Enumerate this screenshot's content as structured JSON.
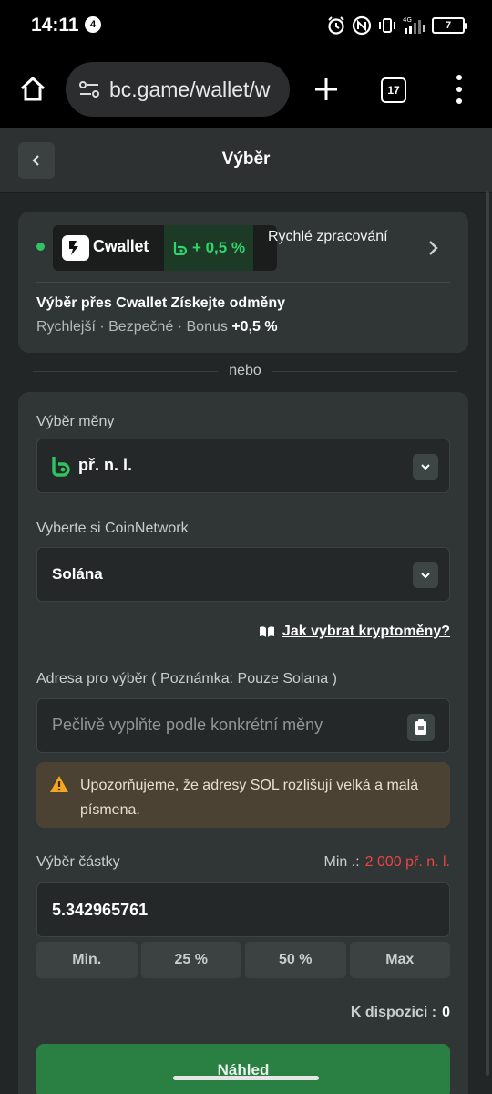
{
  "status_bar": {
    "time": "14:11",
    "notification_count": "4",
    "network": "4G",
    "battery": "7"
  },
  "browser": {
    "url": "bc.game/wallet/w",
    "tab_count": "17"
  },
  "header": {
    "title": "Výběr"
  },
  "cwallet": {
    "brand": "Cwallet",
    "bonus": "+ 0,5 %",
    "fast_processing": "Rychlé zpracování",
    "headline": "Výběr přes Cwallet Získejte odměny",
    "perks": "Rychlejší · Bezpečné · Bonus",
    "perks_bonus": "+0,5 %"
  },
  "separator": "nebo",
  "form": {
    "currency_label": "Výběr měny",
    "currency_value": "př. n. l.",
    "network_label": "Vyberte si CoinNetwork",
    "network_value": "Solána",
    "help_link": "Jak vybrat kryptoměny?",
    "address_label": "Adresa pro výběr ( Poznámka: Pouze Solana )",
    "address_placeholder": "Pečlivě vyplňte podle konkrétní měny",
    "warning": "Upozorňujeme, že adresy SOL rozlišují velká a malá písmena.",
    "amount_label": "Výběr částky",
    "min_label": "Min .:",
    "min_value": "2 000 př. n. l.",
    "amount_value": "5.342965761",
    "quick_buttons": [
      "Min.",
      "25 %",
      "50 %",
      "Max"
    ],
    "available_label": "K dispozici :",
    "available_value": "0",
    "preview_button": "Náhled"
  },
  "colors": {
    "accent_green": "#2fd66b",
    "button_green": "#2a7f43",
    "warning_bg": "#4b4234",
    "min_red": "#ee4444",
    "background": "#232626"
  }
}
